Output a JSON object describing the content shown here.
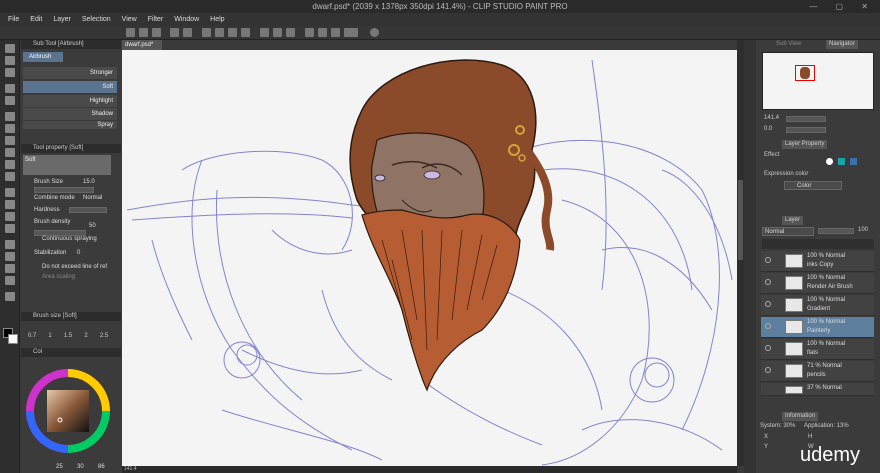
{
  "title": "dwarf.psd* (2039 x 1378px 350dpi 141.4%) - CLIP STUDIO PAINT PRO",
  "menu": [
    "File",
    "Edit",
    "Layer",
    "Selection",
    "View",
    "Filter",
    "Window",
    "Help"
  ],
  "canvas_tab": "dwarf.psd*",
  "subtool_panel": {
    "title": "Sub Tool [Airbrush]",
    "group": "Airbrush",
    "brushes": [
      "Stronger",
      "Soft",
      "Highlight",
      "Shadow",
      "Spray"
    ],
    "selected": "Soft"
  },
  "tool_property": {
    "title": "Tool property [Soft]",
    "name": "Soft",
    "brush_size_label": "Brush Size",
    "brush_size": "15.0",
    "combine_mode_label": "Combine mode",
    "combine_mode": "Normal",
    "hardness_label": "Hardness",
    "brush_density_label": "Brush density",
    "brush_density": "50",
    "continuous_spraying": "Continuous spraying",
    "stabilization_label": "Stabilization",
    "stabilization": "0",
    "no_extend": "Do not exceed line of ref",
    "area_scaling": "Area scaling"
  },
  "brush_size_panel": {
    "title": "Brush size [Soft]",
    "sizes": [
      "0.7",
      "1",
      "1.5",
      "2",
      "2.5"
    ]
  },
  "color_panel": {
    "label": "Col",
    "values": [
      "25",
      "30",
      "86"
    ]
  },
  "navigator": {
    "tabs": [
      "Sub View",
      "Navigator"
    ],
    "zoom": "141.4",
    "rotation": "0.0"
  },
  "layer_property": {
    "title": "Layer Property",
    "effect_label": "Effect",
    "expression_color_label": "Expression color",
    "expression_color": "Color"
  },
  "layer_panel": {
    "title": "Layer",
    "blend_mode": "Normal",
    "opacity": "100",
    "layers": [
      {
        "opacity": "100 %",
        "mode": "Normal",
        "name": "inks Copy"
      },
      {
        "opacity": "100 %",
        "mode": "Normal",
        "name": "Render Air Brush"
      },
      {
        "opacity": "100 %",
        "mode": "Normal",
        "name": "Gradient"
      },
      {
        "opacity": "100 %",
        "mode": "Normal",
        "name": "Painterly",
        "selected": true
      },
      {
        "opacity": "100 %",
        "mode": "Normal",
        "name": "flats"
      },
      {
        "opacity": "71 %",
        "mode": "Normal",
        "name": "pencils"
      },
      {
        "opacity": "37 %",
        "mode": "Normal",
        "name": ""
      }
    ]
  },
  "info_panel": {
    "title": "Information",
    "system": "System: 30%",
    "application": "Application: 13%",
    "x": "X",
    "y": "Y",
    "h": "H",
    "w": "W"
  },
  "status_zoom": "141.4",
  "watermark": "udemy",
  "colors": {
    "hair": "#8b4a2a",
    "beard": "#b65d33",
    "skin": "#8f7466",
    "sketch": "#6e72c8",
    "selection": "#5e7f9e"
  }
}
